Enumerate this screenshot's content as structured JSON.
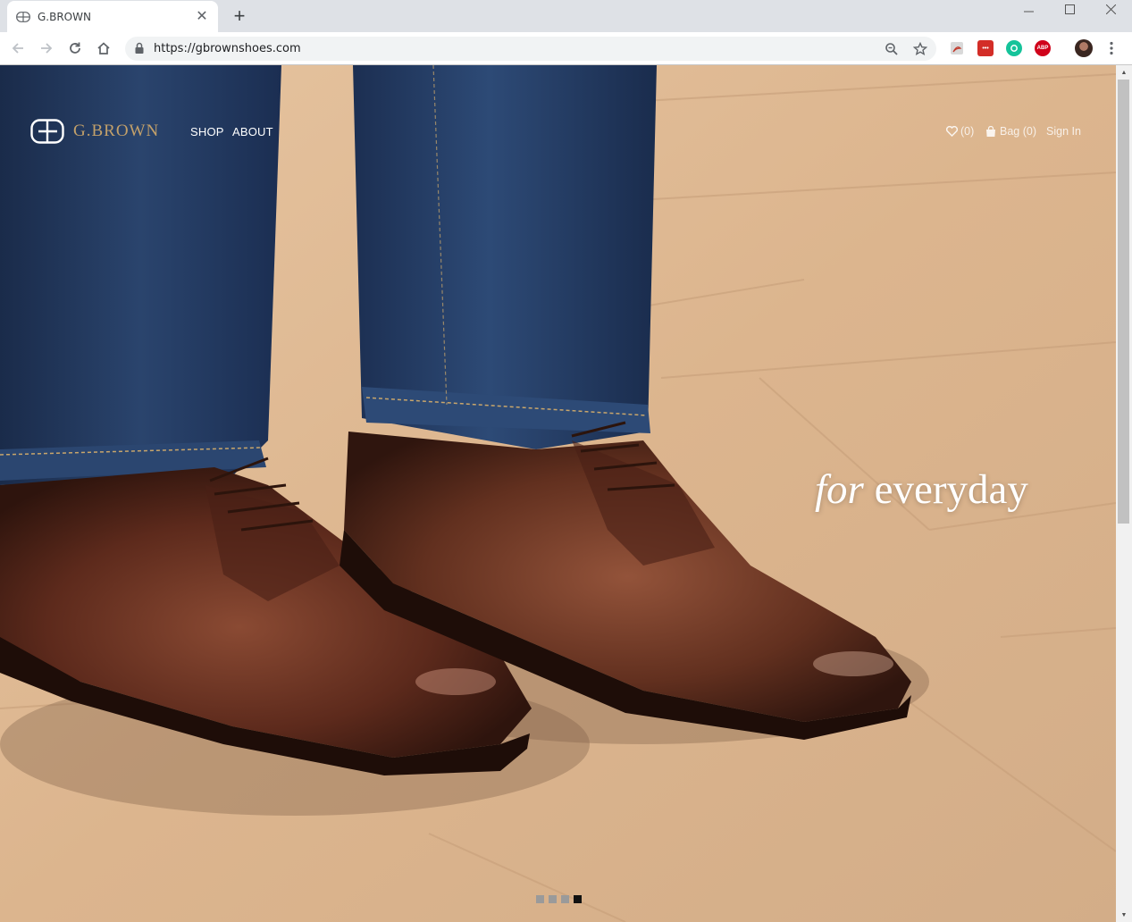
{
  "browser": {
    "tab_title": "G.BROWN",
    "url": "https://gbrownshoes.com",
    "extensions": [
      "acrobat-icon",
      "lastpass-icon",
      "grammarly-icon",
      "adblock-plus-icon",
      "profile-avatar"
    ],
    "adblock_label": "ABP",
    "lastpass_label": "•••"
  },
  "site": {
    "logo_text": "G.BROWN",
    "nav": {
      "shop": "SHOP",
      "about": "ABOUT"
    },
    "header_right": {
      "wishlist": "(0)",
      "bag": "Bag (0)",
      "sign_in": "Sign In"
    },
    "hero": {
      "tagline_italic": "for",
      "tagline_rest": " everyday"
    },
    "slides": {
      "count": 4,
      "active_index": 3
    }
  },
  "colors": {
    "logo_gold": "#c2a06a",
    "chrome_bg": "#dee1e6",
    "pavement": "#dcb892",
    "denim": "#22385c",
    "leather": "#5d2a1c"
  }
}
